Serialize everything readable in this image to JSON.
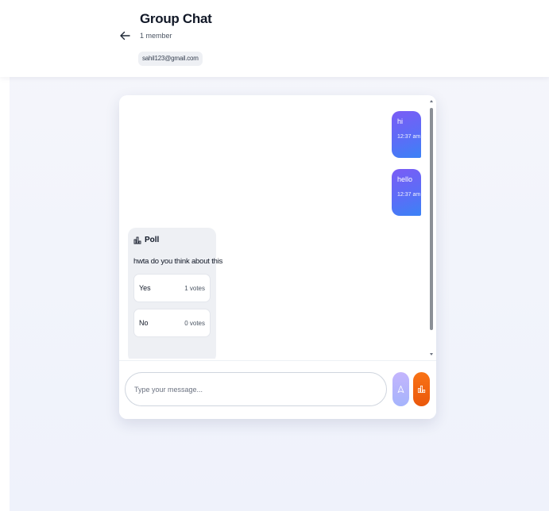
{
  "header": {
    "title": "Group Chat",
    "members": "1 member",
    "email": "sahil123@gmail.com"
  },
  "messages": [
    {
      "text": "hi",
      "time": "12:37 am"
    },
    {
      "text": "hello",
      "time": "12:37 am"
    }
  ],
  "poll": {
    "label": "Poll",
    "question": "hwta do you think about this",
    "options": [
      {
        "label": "Yes",
        "votes": "1 votes"
      },
      {
        "label": "No",
        "votes": "0 votes"
      }
    ]
  },
  "composer": {
    "placeholder": "Type your message..."
  },
  "colors": {
    "accent_gradient_start": "#7b5cf5",
    "accent_gradient_end": "#3b82f6",
    "poll_button": "#f97316",
    "send_button": "#c4b5fd"
  },
  "icons": {
    "back": "arrow-left-icon",
    "poll": "bar-chart-icon",
    "send": "send-icon"
  }
}
